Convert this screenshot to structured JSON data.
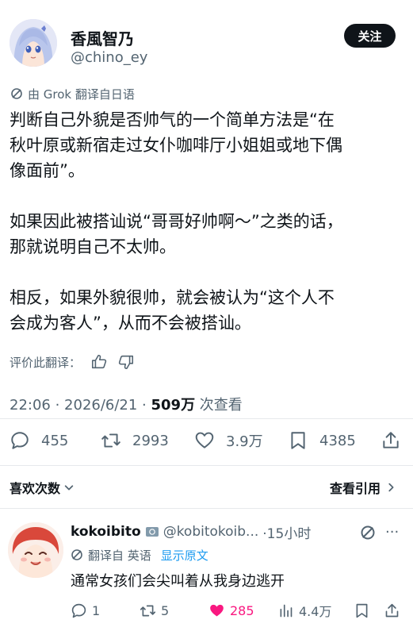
{
  "tweet": {
    "display_name": "香風智乃",
    "handle": "@chino_ey",
    "follow_label": "关注",
    "translated_by": "由 Grok 翻译自日语",
    "paragraphs": [
      "判断自己外貌是否帅气的一个简单方法是“在\n秋叶原或新宿走过女仆咖啡厅小姐姐或地下偶\n像面前”。",
      "如果因此被搭讪说“哥哥好帅啊～”之类的话，\n那就说明自己不太帅。",
      "相反，如果外貌很帅，就会被认为“这个人不\n会成为客人”，从而不会被搭讪。"
    ],
    "rate_translation": "评价此翻译：",
    "timestamp": "22:06 · 2026/6/21 · ",
    "views_count": "509万",
    "views_label": " 次查看",
    "stats": {
      "replies": "455",
      "retweets": "2993",
      "likes": "3.9万",
      "bookmarks": "4385"
    },
    "likes_link": "喜欢次数",
    "quotes_link": "查看引用"
  },
  "reply": {
    "display_name": "kokoibito",
    "handle": "@kobitokoib...",
    "time": "·15小时",
    "translated_from": "翻译自 英语",
    "show_original": "显示原文",
    "text": "通常女孩们会尖叫着从我身边逃开",
    "stats": {
      "replies": "1",
      "retweets": "5",
      "likes": "285",
      "views": "4.4万"
    }
  },
  "colors": {
    "text": "#0f1419",
    "secondary": "#536471",
    "link": "#1d9bf0",
    "like_active": "#f91880",
    "badge": "#829aab"
  }
}
